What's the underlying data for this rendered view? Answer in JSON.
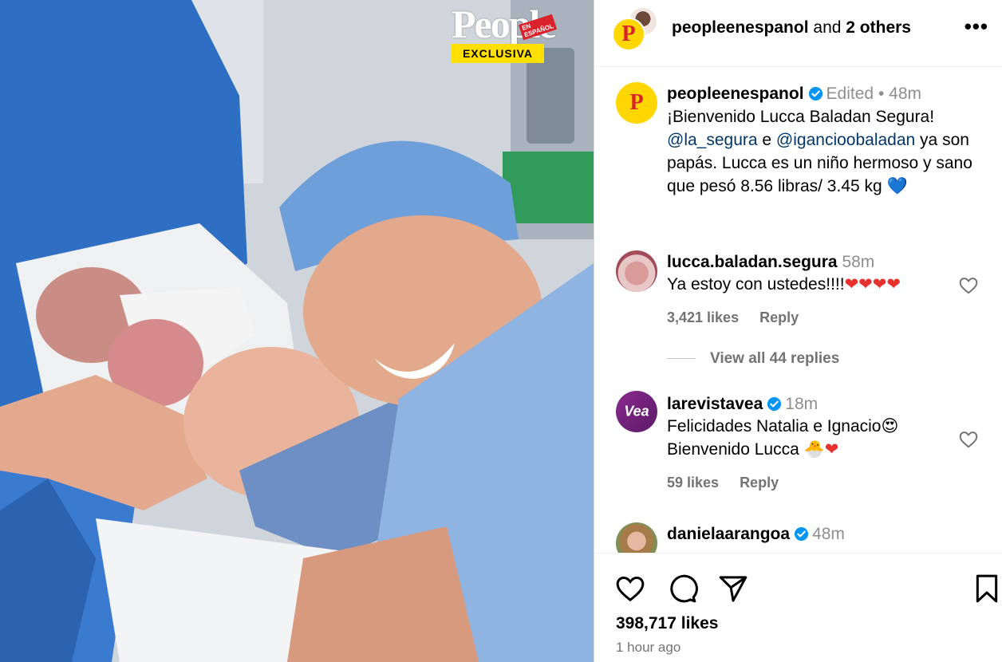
{
  "photo": {
    "brand": "People",
    "brand_badge": "EN ESPAÑOL",
    "tag": "EXCLUSIVA"
  },
  "header": {
    "username": "peopleenespanol",
    "joiner": "and",
    "others": "2 others",
    "more": "•••"
  },
  "caption": {
    "username": "peopleenespanol",
    "edited": "Edited",
    "dot": "•",
    "time": "48m",
    "line1": "¡Bienvenido Lucca Baladan Segura!",
    "mention1": "@la_segura",
    "mid": " e ",
    "mention2": "@igancioobaladan",
    "rest": " ya son papás. Lucca es un niño hermoso y sano que pesó 8.56 libras/ 3.45 kg ",
    "emoji": "💙"
  },
  "comments": [
    {
      "username": "lucca.baladan.segura",
      "time": "58m",
      "text": "Ya estoy con ustedes!!!!",
      "emoji": "❤❤❤❤",
      "likes": "3,421 likes",
      "reply": "Reply",
      "view_replies": "View all 44 replies"
    },
    {
      "username": "larevistavea",
      "avatar_text": "Vea",
      "time": "18m",
      "text1": "Felicidades Natalia e Ignacio",
      "emoji1": "😍",
      "text2": "Bienvenido Lucca ",
      "emoji2": "🐣❤",
      "likes": "59 likes",
      "reply": "Reply"
    },
    {
      "username": "danielaarangoa",
      "time": "48m"
    }
  ],
  "footer": {
    "likes": "398,717 likes",
    "time": "1 hour ago"
  },
  "colors": {
    "verified": "#0095f6",
    "link": "#00376b",
    "muted": "#8e8e8e"
  }
}
